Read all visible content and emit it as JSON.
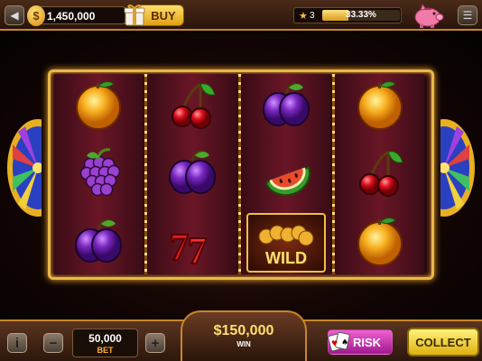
{
  "top_bar": {
    "menu_left_icon": "triangle-left-icon",
    "coins": "1,450,000",
    "coin_symbol": "$",
    "buy_label": "BUY",
    "level": "3",
    "xp_percent_text": "33.33%",
    "xp_fraction": 0.3333,
    "piggy_icon": "piggy-bank-icon",
    "menu_right_icon": "hamburger-icon"
  },
  "reels": [
    [
      "orange",
      "grape",
      "plum"
    ],
    [
      "cherry",
      "plum",
      "seven"
    ],
    [
      "plum",
      "watermelon",
      "wild"
    ],
    [
      "orange",
      "cherry",
      "orange"
    ]
  ],
  "wild_label": "WILD",
  "seven_label": "7",
  "bottom_bar": {
    "info_label": "i",
    "minus_label": "−",
    "bet_value": "50,000",
    "bet_label": "BET",
    "plus_label": "+",
    "win_value": "$150,000",
    "win_label": "WIN",
    "risk_label": "RISK",
    "collect_label": "COLLECT"
  },
  "colors": {
    "gold": "#e8b84a",
    "risk_pink": "#d040b8",
    "collect_yellow": "#f4d030"
  }
}
